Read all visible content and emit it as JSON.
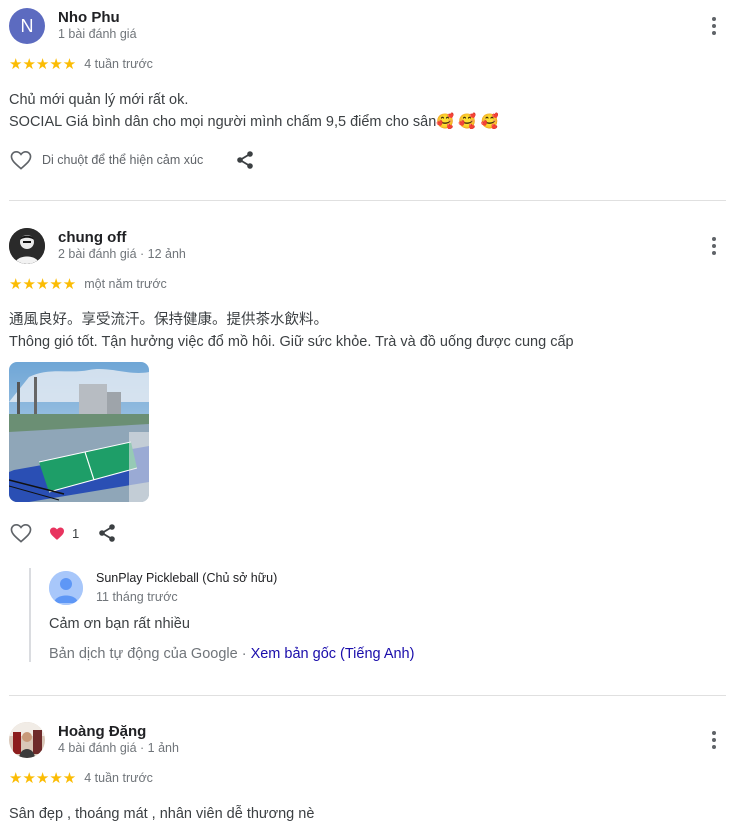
{
  "reviews": [
    {
      "name": "Nho Phu",
      "avatar_letter": "N",
      "meta": "1 bài đánh giá",
      "stars": "★★★★★",
      "ago": "4 tuần trước",
      "text_line1": "Chủ mới quản lý mới rất ok.",
      "text_line2": "SOCIAL Giá bình dân cho mọi người mình chấm 9,5 điểm cho sân🥰 🥰 🥰",
      "react_hint": "Di chuột để thể hiện cảm xúc"
    },
    {
      "name": "chung off",
      "meta": "2 bài đánh giá · 12 ảnh",
      "stars": "★★★★★",
      "ago": "một năm trước",
      "text_line1": "通風良好。享受流汗。保持健康。提供茶水飲料。",
      "text_line2": "Thông gió tốt. Tận hưởng việc đổ mồ hôi. Giữ sức khỏe. Trà và đồ uống được cung cấp",
      "like_count": "1",
      "owner": {
        "name": "SunPlay Pickleball (Chủ sở hữu)",
        "ago": "11 tháng trước",
        "text": "Cảm ơn bạn rất nhiều",
        "translate_note": "Bản dịch tự động của Google · ",
        "translate_link": "Xem bản gốc (Tiếng Anh)"
      }
    },
    {
      "name": "Hoàng Đặng",
      "meta": "4 bài đánh giá · 1 ảnh",
      "stars": "★★★★★",
      "ago": "4 tuần trước",
      "text_line1": "Sân đẹp , thoáng mát , nhân viên dễ thương nè"
    }
  ],
  "colors": {
    "star": "#fbbc04",
    "link": "#1a0dab",
    "avatar_letter_bg": "#5c6bc0"
  }
}
